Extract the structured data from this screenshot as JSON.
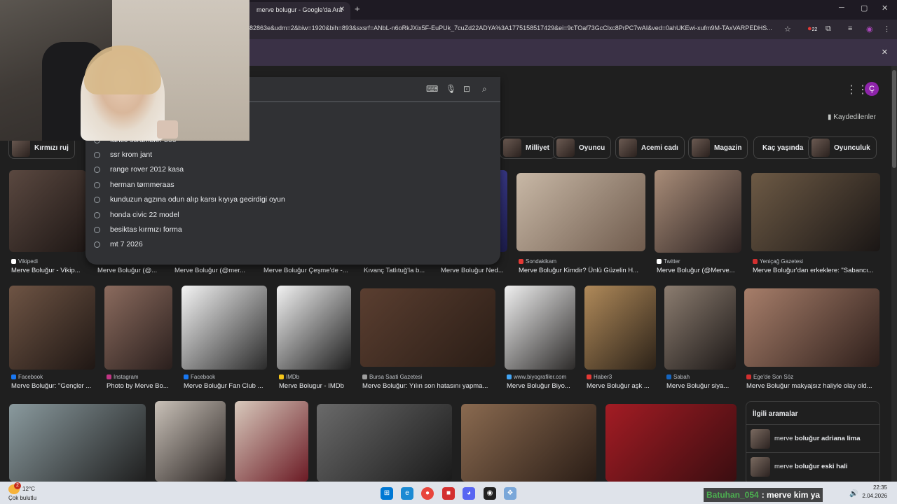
{
  "browser": {
    "tab_title": "merve bolugur - Google'da Ara",
    "tab_close": "✕",
    "new_tab": "+",
    "url": "82863e&udm=2&biw=1920&bih=893&sxsrf=ANbL-n6oRkJXix5F-EuPUk_7cuZd22ADYA%3A1775158517429&ei=9cTOaf73GcClxc8PrPC7wAI&ved=0ahUKEwi-xufm9M-TAxVARPEDHS...",
    "extension_badge": "22",
    "win_min": "─",
    "win_max": "▢",
    "win_close": "✕",
    "infobar_close": "✕"
  },
  "google": {
    "avatar_letter": "Ç",
    "saved_label": "Kaydedilenler",
    "chips": [
      "Kırmızı ruj",
      "Milliyet",
      "Oyuncu",
      "Acemi cadı",
      "Magazin",
      "Kaç yaşında",
      "Oyunculuk"
    ]
  },
  "suggestions": [
    "fantic scrambler 500",
    "ssr krom jant",
    "range rover 2012 kasa",
    "herman tømmeraas",
    "kunduzun agzına odun alıp karsı kıyıya gecirdigi oyun",
    "honda civic 22 model",
    "besiktas kırmızı forma",
    "mt 7 2026"
  ],
  "results_row1": [
    {
      "source": "Vikipedi",
      "title": "Merve Boluğur - Vikip...",
      "fav": "#ffffff"
    },
    {
      "source": "",
      "title": "Merve Boluğur (@...",
      "fav": ""
    },
    {
      "source": "",
      "title": "Merve Boluğur (@mer...",
      "fav": ""
    },
    {
      "source": "",
      "title": "Merve Boluğur Çeşme'de -...",
      "fav": ""
    },
    {
      "source": "",
      "title": "Kıvanç Tatlıtuğ'la b...",
      "fav": ""
    },
    {
      "source": "",
      "title": "Merve Boluğur Ned...",
      "fav": ""
    },
    {
      "source": "Sondakikam",
      "title": "Merve Boluğur Kimdir? Ünlü Güzelin H...",
      "fav": "#e53935"
    },
    {
      "source": "Twitter",
      "title": "Merve Boluğur (@Merve...",
      "fav": "#ffffff"
    },
    {
      "source": "Yeniçağ Gazetesi",
      "title": "Merve Boluğur'dan erkeklere: \"Sabancı...",
      "fav": "#d32f2f"
    }
  ],
  "results_row2": [
    {
      "source": "Facebook",
      "title": "Merve Boluğur: \"Gençler ...",
      "fav": "#1877f2"
    },
    {
      "source": "Instagram",
      "title": "Photo by Merve Bo...",
      "fav": "#c13584"
    },
    {
      "source": "Facebook",
      "title": "Merve Boluğur Fan Club ...",
      "fav": "#1877f2"
    },
    {
      "source": "IMDb",
      "title": "Merve Bolugur - IMDb",
      "fav": "#f5c518"
    },
    {
      "source": "Bursa Saati Gazetesi",
      "title": "Merve Boluğur: Yılın son hatasını yapma...",
      "fav": "#9e9e9e"
    },
    {
      "source": "www.biyografiler.com",
      "title": "Merve Boluğur Biyo...",
      "fav": "#42a5f5"
    },
    {
      "source": "Haber3",
      "title": "Merve Boluğur aşk ...",
      "fav": "#e53935"
    },
    {
      "source": "Sabah",
      "title": "Merve Boluğur siya...",
      "fav": "#1565c0"
    },
    {
      "source": "Ege'de Son Söz",
      "title": "Merve Boluğur makyajsız haliyle olay old...",
      "fav": "#d32f2f"
    }
  ],
  "related": {
    "heading": "İlgili aramalar",
    "items": [
      {
        "prefix": "merve ",
        "bold": "boluğur adriana lima"
      },
      {
        "prefix": "merve ",
        "bold": "boluğur eski hali"
      }
    ]
  },
  "taskbar": {
    "weather_badge": "2",
    "temp": "12°C",
    "condition": "Çok bulutlu",
    "time": "22:35",
    "date": "2.04.2026"
  },
  "chat_overlay": {
    "user": "Batuhan_054",
    "message": ": merve kim ya"
  }
}
